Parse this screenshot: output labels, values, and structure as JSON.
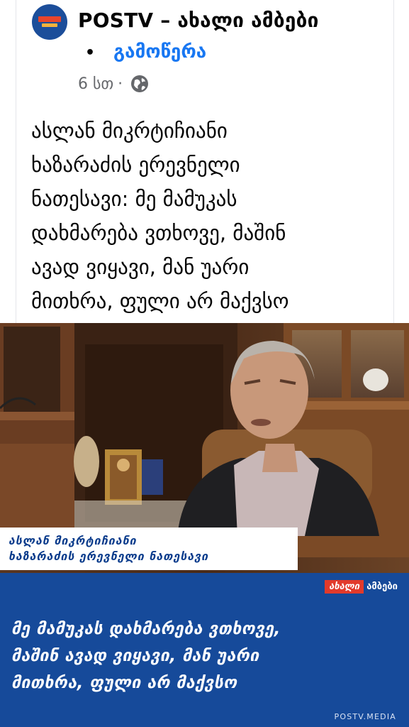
{
  "post": {
    "page_name": "POSTV – ახალი ამბები",
    "bullet": "•",
    "follow_label": "გამოწერა",
    "time": "6 სთ",
    "meta_separator": "·",
    "caption_lines": [
      "ასლან მიკრტიჩიანი",
      "ხაზარაძის ერევნელი",
      "ნათესავი: მე მამუკას",
      "დახმარება ვთხოვე, მაშინ",
      "ავად ვიყავი, მან უარი",
      "მითხრა, ფული არ მაქვსო"
    ]
  },
  "image": {
    "name_lines": [
      "ასლან მიკრტიჩიანი",
      "ხაზარაძის  ერევნელი ნათესავი"
    ],
    "brand_red": "ახალი",
    "brand_white": "ამბები",
    "quote_lines": [
      "მე მამუკას დახმარება ვთხოვე,",
      "მაშინ ავად ვიყავი, მან უარი",
      "მითხრა, ფული არ მაქვსო"
    ],
    "site": "POSTV.MEDIA"
  },
  "icons": {
    "avatar": "postv-logo",
    "privacy": "globe-icon"
  },
  "colors": {
    "follow": "#1877f2",
    "lower_third": "#164a9a",
    "brand_red": "#e23a2b"
  }
}
